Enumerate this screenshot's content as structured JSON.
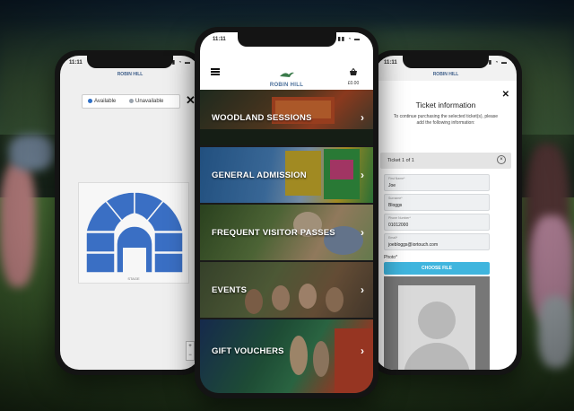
{
  "colors": {
    "available": "#2f6fc6",
    "unavailable": "#9aa3ad",
    "seat_block": "#3a6fc4",
    "choose_button": "#3fb5de",
    "brand": "#4a6f9a"
  },
  "status_time": "11:11",
  "left_phone": {
    "legend": {
      "available": "Available",
      "unavailable": "Unavailable"
    },
    "close_icon": "close-icon",
    "stage_label": "STAGE",
    "zoom": {
      "plus": "+",
      "minus": "−"
    }
  },
  "center_phone": {
    "brand": "ROBIN HILL",
    "cart_total": "£0.00",
    "menu": [
      {
        "label": "WOODLAND SESSIONS",
        "chevron": "›"
      },
      {
        "label": "GENERAL ADMISSION",
        "chevron": "›"
      },
      {
        "label": "FREQUENT VISITOR PASSES",
        "chevron": "›"
      },
      {
        "label": "EVENTS",
        "chevron": "›"
      },
      {
        "label": "GIFT VOUCHERS",
        "chevron": "›"
      }
    ]
  },
  "right_phone": {
    "brand": "ROBIN HILL",
    "title": "Ticket information",
    "description": "To continue purchasing the selected ticket(s), please add the following information:",
    "ticket_label": "Ticket 1 of 1",
    "fields": [
      {
        "label": "First Name*",
        "value": "Joe"
      },
      {
        "label": "Surname*",
        "value": "Bloggs"
      },
      {
        "label": "Phone Number*",
        "value": "01012000"
      },
      {
        "label": "Email*",
        "value": "joebloggs@iortouch.com"
      }
    ],
    "photo_label": "Photo*",
    "choose_file": "CHOOSE FILE"
  }
}
